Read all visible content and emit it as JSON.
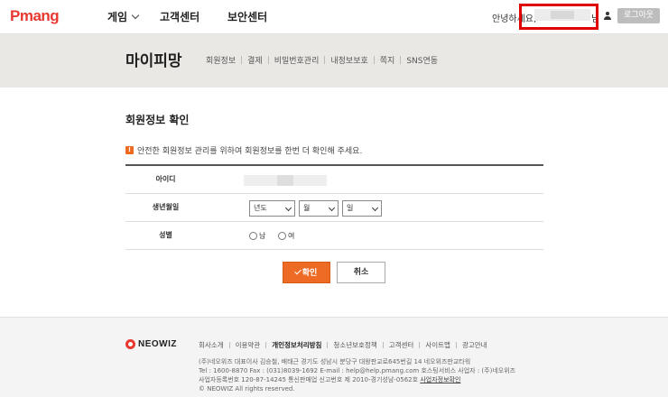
{
  "header": {
    "logo": "Pmang",
    "nav": [
      {
        "label": "게임"
      },
      {
        "label": "고객센터"
      },
      {
        "label": "보안센터"
      }
    ],
    "greeting": "안녕하세요,",
    "greeting_suffix": "님",
    "logout": "로그아웃"
  },
  "subband": {
    "title": "마이피망",
    "nav": [
      "회원정보",
      "결제",
      "비밀번호관리",
      "내정보보호",
      "쪽지",
      "SNS연동"
    ]
  },
  "main": {
    "title": "회원정보 확인",
    "notice_icon": "!",
    "notice": "안전한 회원정보 관리를 위하여 회원정보를 한번 더 확인해 주세요.",
    "fields": {
      "id_label": "아이디",
      "birth_label": "생년월일",
      "year": "년도",
      "month": "월",
      "day": "일",
      "gender_label": "성별",
      "male": "남",
      "female": "여"
    },
    "confirm": "확인",
    "cancel": "취소"
  },
  "footer": {
    "brand": "NEOWIZ",
    "links": [
      "회사소개",
      "이용약관",
      "개인정보처리방침",
      "청소년보호정책",
      "고객센터",
      "사이트맵",
      "광고안내"
    ],
    "info_line1": "(주)네오위즈 대표이사 김승철, 배태근 경기도 성남시 분당구 대왕판교로645번길 14 네오위즈판교타워",
    "info_line2": "Tel : 1600-8870  Fax : (031)8039-1692  E-mail : help@help.pmang.com  호스팅서비스 사업자 : (주)네오위즈",
    "info_line3_prefix": "사업자등록번호 120-87-14245 통신판매업 신고번호 제 2010-경기성남-0562호 ",
    "info_line3_link": "사업자정보확인",
    "copyright": "© NEOWIZ All rights reserved."
  },
  "colors": {
    "logo": "#e8382f",
    "accent": "#ed6b24",
    "band": "#eae8e4",
    "highlight": "#e00000"
  }
}
